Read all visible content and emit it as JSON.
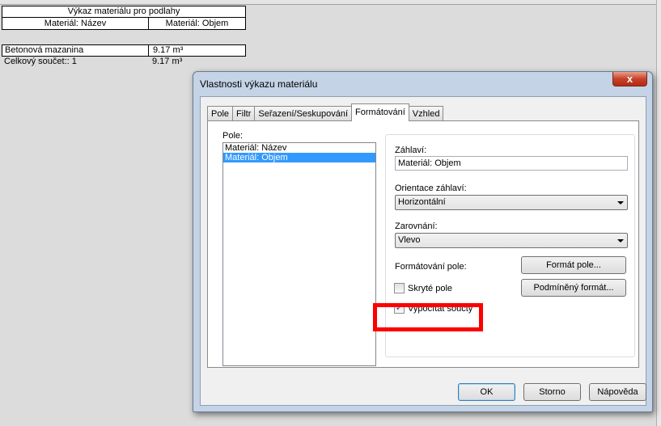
{
  "schedule": {
    "title": "Výkaz materiálu pro podlahy",
    "col1_header": "Materiál: Název",
    "col2_header": "Materiál: Objem",
    "rows": [
      {
        "name": "Betonová mazanina",
        "volume": "9.17 m³"
      }
    ],
    "total_label": "Celkový součet:: 1",
    "total_value": "9.17 m³"
  },
  "dialog": {
    "title": "Vlastnosti výkazu materiálu",
    "close_glyph": "x",
    "tabs": [
      {
        "label": "Pole"
      },
      {
        "label": "Filtr"
      },
      {
        "label": "Seřazení/Seskupování"
      },
      {
        "label": "Formátování"
      },
      {
        "label": "Vzhled"
      }
    ],
    "active_tab": "Formátování",
    "fields_label": "Pole:",
    "fields": [
      {
        "label": "Materiál: Název",
        "selected": false
      },
      {
        "label": "Materiál: Objem",
        "selected": true
      }
    ],
    "heading_label": "Záhlaví:",
    "heading_value": "Materiál: Objem",
    "orientation_label": "Orientace záhlaví:",
    "orientation_value": "Horizontální",
    "alignment_label": "Zarovnání:",
    "alignment_value": "Vlevo",
    "field_format_label": "Formátování pole:",
    "field_format_button": "Formát pole...",
    "hidden_field_label": "Skryté pole",
    "hidden_field_checked": false,
    "conditional_format_button": "Podmíněný formát...",
    "calc_totals_label": "Vypočítat součty",
    "calc_totals_checked": true,
    "checkmark": "✓",
    "ok_button": "OK",
    "cancel_button": "Storno",
    "help_button": "Nápověda",
    "highlight_color": "#ff0000"
  }
}
